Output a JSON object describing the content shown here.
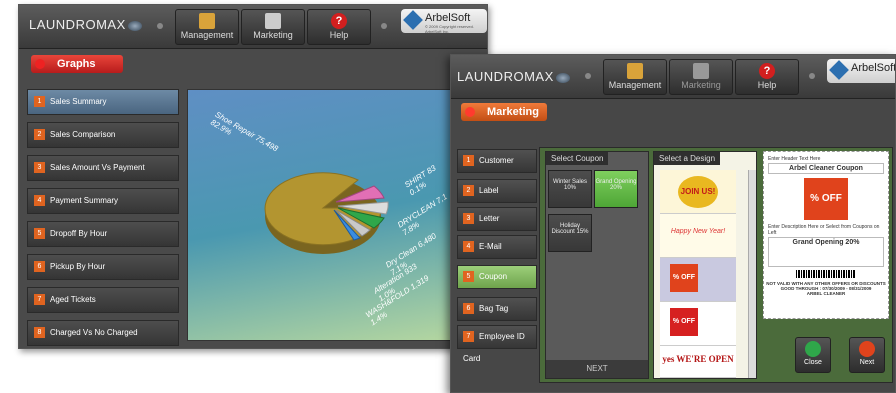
{
  "graphs_window": {
    "logo": "LAUNDROMAX",
    "nav": [
      {
        "label": "Management",
        "icon": "management-icon"
      },
      {
        "label": "Marketing",
        "icon": "marketing-icon"
      },
      {
        "label": "Help",
        "icon": "help-icon"
      }
    ],
    "brand": {
      "name": "ArbelSoft",
      "small": "© 2009 Copyright reserved. ArbelSoft Inc."
    },
    "section_button": "Graphs",
    "menu": [
      {
        "num": "1",
        "label": "Sales Summary",
        "active": true
      },
      {
        "num": "2",
        "label": "Sales Comparison"
      },
      {
        "num": "3",
        "label": "Sales Amount Vs Payment"
      },
      {
        "num": "4",
        "label": "Payment Summary"
      },
      {
        "num": "5",
        "label": "Dropoff By Hour"
      },
      {
        "num": "6",
        "label": "Pickup By Hour"
      },
      {
        "num": "7",
        "label": "Aged Tickets"
      },
      {
        "num": "8",
        "label": "Charged Vs No Charged"
      }
    ],
    "pie_labels": [
      {
        "text": "Shoe Repair 75,498",
        "line2": "82.9%"
      },
      {
        "text": "SHIRT 83",
        "line2": "0.1%"
      },
      {
        "text": "DRYCLEAN 7,1",
        "line2": "7.8%"
      },
      {
        "text": "Dry Clean 6,480",
        "line2": "7.1%"
      },
      {
        "text": "Alteration 933",
        "line2": "1.0%"
      },
      {
        "text": "WASH&FOLD 1,319",
        "line2": "1.4%"
      }
    ]
  },
  "marketing_window": {
    "logo": "LAUNDROMAX",
    "nav": [
      {
        "label": "Management",
        "icon": "management-icon"
      },
      {
        "label": "Marketing",
        "icon": "marketing-icon"
      },
      {
        "label": "Help",
        "icon": "help-icon"
      }
    ],
    "brand": {
      "name": "ArbelSoft"
    },
    "section_button": "Marketing",
    "menu": [
      {
        "num": "1",
        "label": "Customer"
      },
      {
        "num": "2",
        "label": "Label"
      },
      {
        "num": "3",
        "label": "Letter"
      },
      {
        "num": "4",
        "label": "E-Mail"
      },
      {
        "num": "5",
        "label": "Coupon",
        "active": true
      },
      {
        "num": "6",
        "label": "Bag Tag"
      },
      {
        "num": "7",
        "label": "Employee ID Card"
      }
    ],
    "select_coupon_title": "Select Coupon",
    "coupons": [
      {
        "label": "Winter Sales 10%"
      },
      {
        "label": "Grand Opening 20%",
        "selected": true
      },
      {
        "label": "Holiday Discount 15%"
      }
    ],
    "next_label": "NEXT",
    "select_design_title": "Select a Design",
    "designs": [
      "JOIN US!",
      "Happy New Year!",
      "% OFF",
      "% OFF",
      "yes WE'RE OPEN"
    ],
    "preview": {
      "header_hint": "Enter Header Text Here",
      "header": "Arbel Cleaner Coupon",
      "desc_hint": "Enter Description Here or Select from Coupons on Left",
      "description": "Grand Opening 20%",
      "footer1": "NOT VALID WITH ANY OTHER OFFERS OR DISCOUNTS",
      "footer2": "GOOD THROUGH : 07/30/2009 - 08/31/2009",
      "footer3": "ARBEL CLEANER"
    },
    "close_label": "Close",
    "next_button_label": "Next"
  }
}
